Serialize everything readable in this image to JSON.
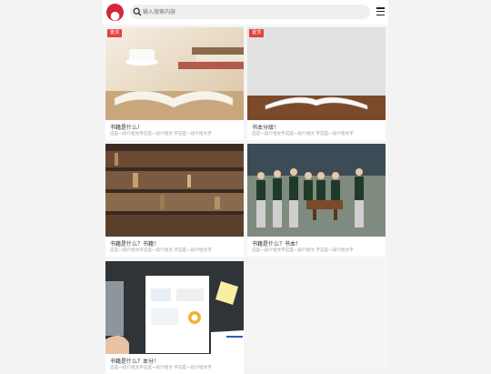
{
  "header": {
    "search_placeholder": "输入搜索内容"
  },
  "cards": [
    {
      "badge": "置顶",
      "title": "书籍是什么！",
      "desc": "这是一段介绍文字这是一段介绍文 字这是一段介绍文字"
    },
    {
      "badge": "置顶",
      "title": "书本分级！",
      "desc": "这是一段介绍文字这是一段介绍文 字这是一段介绍文字"
    },
    {
      "title": "书籍是什么？书籍！",
      "desc": "这是一段介绍文字这是一段介绍文 字这是一段介绍文字"
    },
    {
      "title": "书籍是什么？书本！",
      "desc": "这是一段介绍文字这是一段介绍文 字这是一段介绍文字"
    },
    {
      "title": "书籍是什么？本分！",
      "desc": "这是一段介绍文字这是一段介绍文 字这是一段介绍文字"
    }
  ]
}
